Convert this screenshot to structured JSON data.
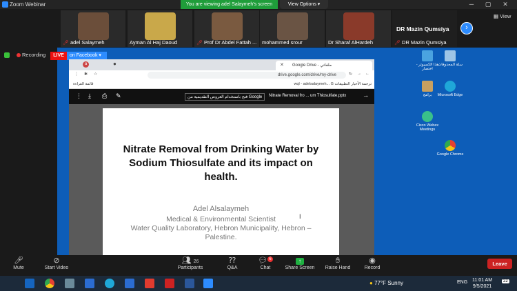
{
  "window": {
    "title": "Zoom Webinar"
  },
  "banner": {
    "viewing": "You are viewing adel Salaymeh's screen",
    "view_options": "View Options ▾"
  },
  "gallery": {
    "participants": [
      {
        "name": "adel Salaymeh",
        "muted": true,
        "color": "#6b4e3a"
      },
      {
        "name": "Ayman Al Haj Daoud",
        "muted": false,
        "color": "#c9a84a"
      },
      {
        "name": "Prof Dr Abdel Fattah ...",
        "muted": true,
        "color": "#7a5a40"
      },
      {
        "name": "mohammed srour",
        "muted": false,
        "color": "#6a5444"
      },
      {
        "name": "Dr Sharaf AlHardeh",
        "muted": false,
        "color": "#8a3a2a"
      },
      {
        "name": "DR Mazin Qumsiya",
        "muted": true,
        "color": "#2a2a2a"
      }
    ],
    "mazin_title": "DR Mazin Qumsiya",
    "view_label": "View"
  },
  "status": {
    "recording": "Recording",
    "live": "LIVE",
    "on_facebook": "on Facebook ▾"
  },
  "desktop_icons": [
    {
      "label": "هذا الكمبيوتر - اختصار",
      "color": "#4aa3e0"
    },
    {
      "label": "سلة المحذوفات",
      "color": "#9ec5e6"
    },
    {
      "label": "برامج",
      "color": "#c8a060"
    },
    {
      "label": "Microsoft Edge",
      "color": "#1fa7d8"
    },
    {
      "label": "Cisco Webex Meetings",
      "color": "#39c08a"
    },
    {
      "label": "Google Chrome",
      "color": "#e34133"
    }
  ],
  "browser": {
    "tab_title": "Google Drive - ملفاتي",
    "url": "drive.google.com/drive/my-drive",
    "bookmarks_left": "قائمة القراءة",
    "bookmarks_right": "wql - adelsalaymeh...  G  ترجمة  الأخبار  التطبيقات",
    "file_title": "Nitrate Removal fro ... um Thiosulfate.pptx",
    "open_with": "فتح باستخدام العروض التقديمية من Google"
  },
  "slide": {
    "title": "Nitrate Removal from Drinking Water by Sodium Thiosulfate and its impact on health.",
    "author": "Adel Alsalaymeh",
    "role": "Medical & Environmental Scientist",
    "affiliation": "Water Quality Laboratory, Hebron Municipality, Hebron – Palestine."
  },
  "toolbar": {
    "mute": "Mute",
    "start_video": "Start Video",
    "participants": "Participants",
    "participants_count": "26",
    "qa": "Q&A",
    "chat": "Chat",
    "chat_badge": "6",
    "share_screen": "Share Screen",
    "raise_hand": "Raise Hand",
    "record": "Record",
    "leave": "Leave"
  },
  "taskbar": {
    "weather": "77°F  Sunny",
    "lang": "ENG",
    "time": "11:01 AM",
    "date": "9/5/2021",
    "notif": "22"
  }
}
